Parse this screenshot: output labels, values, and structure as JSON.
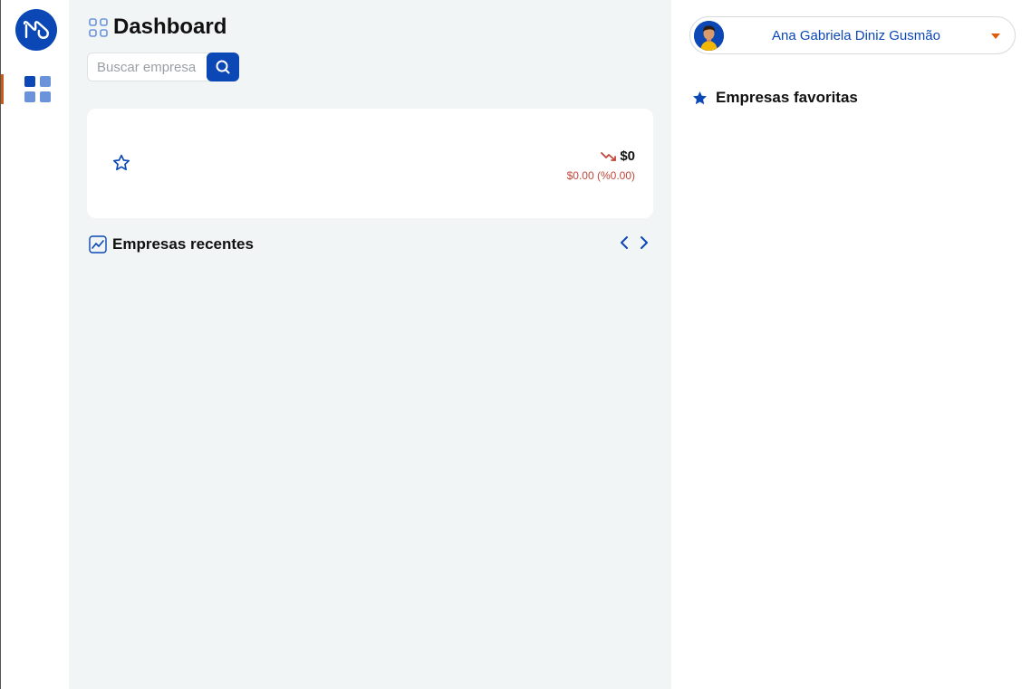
{
  "colors": {
    "brand": "#0b47b5",
    "accent": "#c85a1a",
    "negative": "#c0473c",
    "main_bg": "#f1f5f5"
  },
  "sidebar": {
    "logo_icon": "brand-logo",
    "items": [
      {
        "icon": "dashboard-grid-icon",
        "active": true
      }
    ]
  },
  "header": {
    "title": "Dashboard",
    "title_icon": "grid-outline-icon"
  },
  "search": {
    "placeholder": "Buscar empresa",
    "value": "",
    "button_icon": "search-icon"
  },
  "company_card": {
    "favorite_icon": "star-outline-icon",
    "trend_icon": "trend-down-icon",
    "price": "$0",
    "change": "$0.00 (%0.00)"
  },
  "recent": {
    "title": "Empresas recentes",
    "icon": "chart-line-icon",
    "prev_icon": "chevron-left-icon",
    "next_icon": "chevron-right-icon"
  },
  "user": {
    "name": "Ana Gabriela Diniz Gusmão",
    "avatar_icon": "user-avatar",
    "caret_icon": "caret-down-icon"
  },
  "favorites": {
    "title": "Empresas favoritas",
    "icon": "star-filled-icon"
  }
}
